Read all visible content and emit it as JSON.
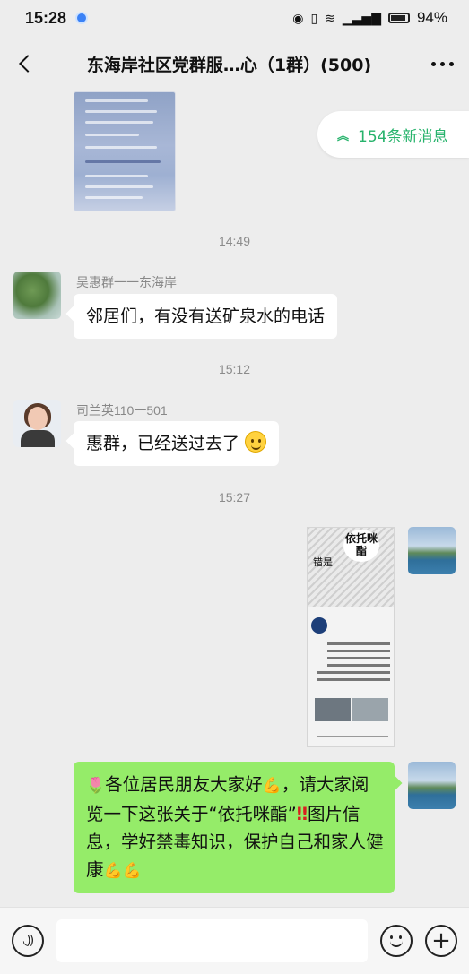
{
  "status_bar": {
    "time": "15:28",
    "battery_percent": "94%",
    "icons": [
      "eye-icon",
      "vibrate-icon",
      "wifi-icon",
      "signal-icon",
      "battery-icon"
    ]
  },
  "header": {
    "title": "东海岸社区党群服…心（1群）(500)"
  },
  "new_messages": {
    "label": "154条新消息"
  },
  "messages": [
    {
      "type": "timestamp",
      "text": "14:49"
    },
    {
      "type": "text",
      "sender": "吴惠群一一东海岸",
      "text": "邻居们，有没有送矿泉水的电话",
      "avatar": "tree-avatar"
    },
    {
      "type": "timestamp",
      "text": "15:12"
    },
    {
      "type": "text",
      "sender": "司兰英110一501",
      "text": "惠群，已经送过去了",
      "emoji": "smile",
      "avatar": "woman-avatar"
    },
    {
      "type": "timestamp",
      "text": "15:27"
    },
    {
      "type": "image",
      "from_self": true,
      "avatar": "seaside-avatar",
      "image_text": {
        "title": "依托咪酯",
        "side": "错是"
      }
    },
    {
      "type": "text",
      "from_self": true,
      "avatar": "seaside-avatar",
      "segments": {
        "s1": "🌷",
        "s2": "各位居民朋友大家好",
        "s3": "💪",
        "s4": "，请大家阅览一下这张关于“依托咪酯”",
        "s5": "‼",
        "s6": "图片信息，学好禁毒知识，保护自己和家人健康",
        "s7": "💪💪"
      }
    }
  ],
  "input_bar": {
    "placeholder": ""
  },
  "colors": {
    "self_bubble": "#95ec69",
    "accent_green": "#27b36c",
    "background": "#ededed"
  }
}
